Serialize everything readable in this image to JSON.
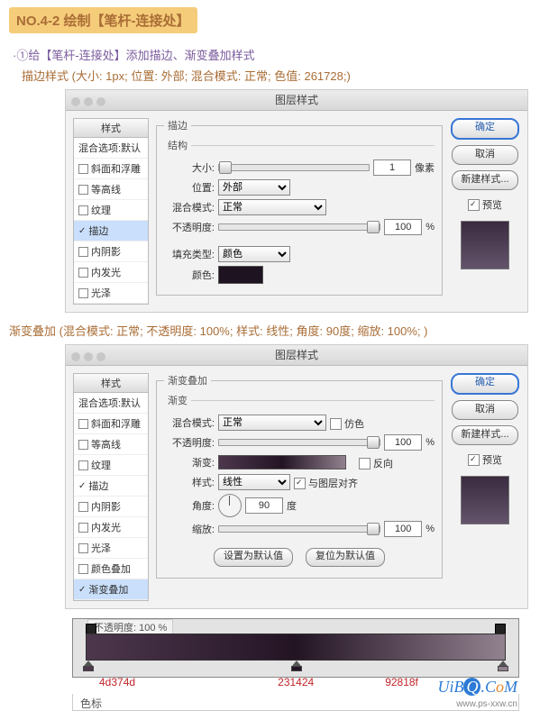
{
  "header_badge": "NO.4-2 绘制【笔杆-连接处】",
  "instr": "·①给【笔杆-连接处】添加描边、渐变叠加样式",
  "stroke_line": "描边样式 (大小: 1px; 位置: 外部; 混合模式: 正常; 色值: 261728;)",
  "overlay_line": "渐变叠加 (混合模式: 正常; 不透明度: 100%; 样式: 线性; 角度: 90度; 缩放: 100%; )",
  "dlg_title": "图层样式",
  "sidebar": {
    "header": "样式",
    "items": [
      "混合选项:默认",
      "斜面和浮雕",
      "等高线",
      "纹理",
      "描边",
      "内阴影",
      "内发光",
      "光泽",
      "颜色叠加",
      "渐变叠加"
    ]
  },
  "buttons": {
    "ok": "确定",
    "cancel": "取消",
    "new_style": "新建样式...",
    "preview": "预览"
  },
  "stroke": {
    "grp": "描边",
    "sub": "结构",
    "size_lbl": "大小:",
    "size_val": "1",
    "size_unit": "像素",
    "pos_lbl": "位置:",
    "pos_val": "外部",
    "blend_lbl": "混合模式:",
    "blend_val": "正常",
    "opac_lbl": "不透明度:",
    "opac_val": "100",
    "pct": "%",
    "fill_lbl": "填充类型:",
    "fill_val": "颜色",
    "color_lbl": "颜色:"
  },
  "grad": {
    "grp": "渐变叠加",
    "sub": "渐变",
    "blend_lbl": "混合模式:",
    "blend_val": "正常",
    "dither": "仿色",
    "opac_lbl": "不透明度:",
    "opac_val": "100",
    "pct": "%",
    "grad_lbl": "渐变:",
    "reverse": "反向",
    "style_lbl": "样式:",
    "style_val": "线性",
    "align": "与图层对齐",
    "angle_lbl": "角度:",
    "angle_val": "90",
    "deg": "度",
    "scale_lbl": "缩放:",
    "scale_val": "100",
    "set_default": "设置为默认值",
    "reset_default": "复位为默认值",
    "extra_label": "不透明度:",
    "extra_val": "100"
  },
  "grad_stops": {
    "a": "4d374d",
    "b": "231424",
    "c": "92818f"
  },
  "wm": "UiBQ.CoM",
  "wm2": "www.ps-xxw.cn",
  "bottom_lbl": "色标"
}
